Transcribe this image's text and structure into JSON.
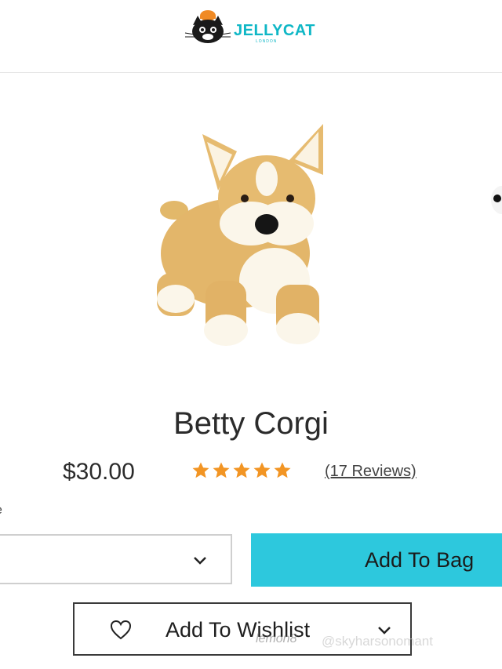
{
  "header": {
    "brand": "JELLYCAT",
    "brand_sub": "LONDON"
  },
  "product": {
    "title": "Betty Corgi",
    "price": "$30.00",
    "rating": 5,
    "reviews_label": "(17 Reviews)"
  },
  "options": {
    "size_label": "e",
    "size_value": ""
  },
  "actions": {
    "add_to_bag": "Add To Bag",
    "add_to_wishlist": "Add To Wishlist"
  },
  "watermark": {
    "app": "lemon8",
    "user": "@skyharsonomant"
  },
  "colors": {
    "accent": "#2dc8dd",
    "star": "#f29524",
    "brand": "#0fb7c6"
  },
  "icons": [
    "jellycat-cat-logo",
    "star-icon",
    "chevron-down-icon",
    "heart-icon"
  ]
}
